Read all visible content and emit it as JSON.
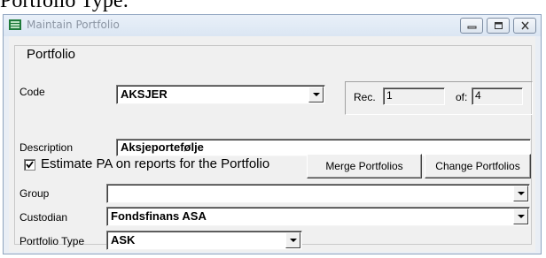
{
  "caption": "Portfolio Type:",
  "window": {
    "title": "Maintain Portfolio",
    "icon": "portfolio-app-icon",
    "controls": [
      "minimize-icon",
      "maximize-icon",
      "close-icon"
    ]
  },
  "group": {
    "legend": "Portfolio"
  },
  "code": {
    "label": "Code",
    "value": "AKSJER"
  },
  "record": {
    "rec_label": "Rec.",
    "rec_value": "1",
    "of_label": "of:",
    "of_value": "4"
  },
  "description": {
    "label": "Description",
    "value": "Aksjeportefølje"
  },
  "estimate": {
    "label": "Estimate PA on reports for the Portfolio",
    "checked": true
  },
  "buttons": {
    "merge": "Merge Portfolios",
    "change": "Change Portfolios"
  },
  "group_field": {
    "label": "Group",
    "value": ""
  },
  "custodian": {
    "label": "Custodian",
    "value": "Fondsfinans ASA"
  },
  "portfolio_type": {
    "label": "Portfolio Type",
    "value": "ASK"
  }
}
